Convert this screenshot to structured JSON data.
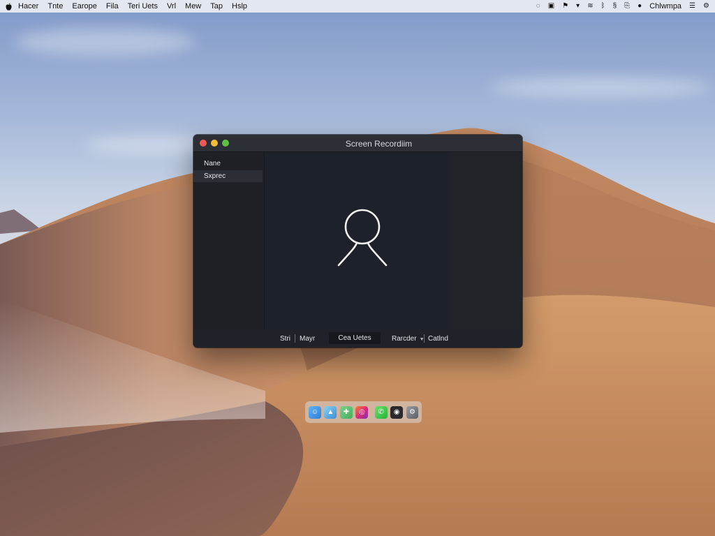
{
  "menubar": {
    "apple_icon": "apple-icon",
    "items": [
      "Hacer",
      "Tnte",
      "Earope",
      "Fila",
      "Teri Uets",
      "Vrl",
      "Mew",
      "Tap",
      "Hslp"
    ],
    "status_icons": [
      "screen-record-icon",
      "file-icon",
      "flag-icon",
      "chevron-down-icon",
      "wifi-icon",
      "bluetooth-icon",
      "script-icon",
      "share-icon",
      "lock-icon"
    ],
    "user": "Chlwmpa",
    "end_icons": [
      "control-center-icon",
      "gear-icon"
    ]
  },
  "window": {
    "title": "Screen Recordiim",
    "sidebar": {
      "items": [
        {
          "label": "Nane",
          "selected": false
        },
        {
          "label": "Sxprec",
          "selected": true
        }
      ]
    },
    "preview": {
      "icon": "person-icon"
    },
    "bottom_bar": {
      "start_label": "Stri",
      "mode_label": "Mayr",
      "field_value": "Cea Uetes",
      "select_label": "Rarcder",
      "options_label": "Catlnd"
    }
  },
  "dock": {
    "apps": [
      "finder-icon",
      "photos-icon",
      "maps-icon",
      "instagram-icon",
      "phone-icon",
      "camera-icon",
      "settings-icon"
    ]
  },
  "colors": {
    "window_bg": "#1f2228",
    "titlebar_bg": "#2c2f35",
    "close": "#ee5a52",
    "minimize": "#f3bb3a",
    "maximize": "#5fc142"
  }
}
